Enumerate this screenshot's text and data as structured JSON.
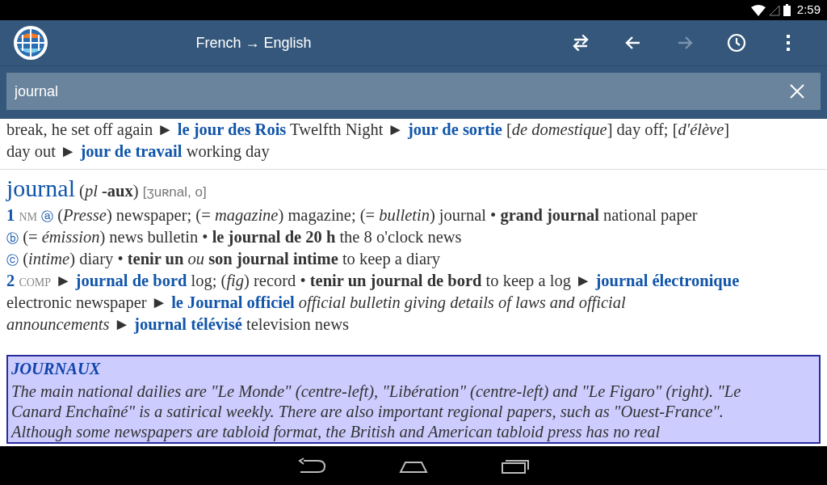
{
  "status_bar": {
    "time": "2:59"
  },
  "app_bar": {
    "title": "French → English",
    "actions": [
      {
        "kind": "swap",
        "disabled": false
      },
      {
        "kind": "back",
        "disabled": false
      },
      {
        "kind": "forward",
        "disabled": true
      },
      {
        "kind": "history",
        "disabled": false
      },
      {
        "kind": "menu",
        "disabled": false
      }
    ]
  },
  "search": {
    "value": "journal"
  },
  "entries": [
    {
      "lines": [
        [
          {
            "kind": "text",
            "text": "break, he set off again ►"
          },
          {
            "kind": "link",
            "text": "le jour des Rois"
          },
          {
            "kind": "text",
            "text": "Twelfth Night ►"
          },
          {
            "kind": "link",
            "text": "jour de sortie"
          },
          {
            "kind": "text",
            "text": "[*de domestique*] day off; [*d'élève*]"
          }
        ],
        [
          {
            "kind": "text",
            "text": "day out ►"
          },
          {
            "kind": "link",
            "text": "jour de travail"
          },
          {
            "kind": "text",
            "text": "working day"
          }
        ]
      ]
    },
    {
      "headword": "journal",
      "grammar": "(*pl* **-aux**)",
      "phonetic": "[ʒuʀnal, o]",
      "lines": [
        [
          {
            "kind": "number",
            "text": "1"
          },
          {
            "kind": "label",
            "text": "NM"
          },
          {
            "kind": "sense",
            "text": "ⓐ"
          },
          {
            "kind": "text",
            "text": "(*Presse*) newspaper; (= *magazine*) magazine; (= *bulletin*) journal • **grand journal** national paper"
          }
        ],
        [
          {
            "kind": "sense",
            "text": "ⓑ"
          },
          {
            "kind": "text",
            "text": "(= *émission*) news bulletin • **le journal de 20 h** the 8 o'clock news"
          }
        ],
        [
          {
            "kind": "sense",
            "text": "ⓒ"
          },
          {
            "kind": "text",
            "text": "(*intime*) diary • **tenir un** *ou* **son journal intime** to keep a diary"
          }
        ],
        [
          {
            "kind": "number",
            "text": "2"
          },
          {
            "kind": "label",
            "text": "COMP"
          },
          {
            "kind": "text",
            "text": "►"
          },
          {
            "kind": "link",
            "text": "journal de bord"
          },
          {
            "kind": "text",
            "text": "log; (*fig*) record • **tenir un journal de bord** to keep a log ►"
          },
          {
            "kind": "link",
            "text": "journal électronique"
          }
        ],
        [
          {
            "kind": "text",
            "text": "electronic newspaper ►"
          },
          {
            "kind": "link",
            "text": "le Journal officiel"
          },
          {
            "kind": "gloss",
            "text": "official bulletin giving details of laws and official"
          }
        ],
        [
          {
            "kind": "gloss",
            "text": "announcements"
          },
          {
            "kind": "text",
            "text": "►"
          },
          {
            "kind": "link",
            "text": "journal télévisé"
          },
          {
            "kind": "text",
            "text": "television news"
          }
        ]
      ]
    }
  ],
  "note": {
    "title": "JOURNAUX",
    "lines": [
      "The main national dailies are \"Le Monde\" (centre-left), \"Libération\" (centre-left) and \"Le Figaro\" (right). \"Le",
      "Canard Enchaîné\" is a satirical weekly. There are also important regional papers, such as \"Ouest-France\".",
      "Although some newspapers are tabloid format, the British and American tabloid press has no real"
    ]
  }
}
